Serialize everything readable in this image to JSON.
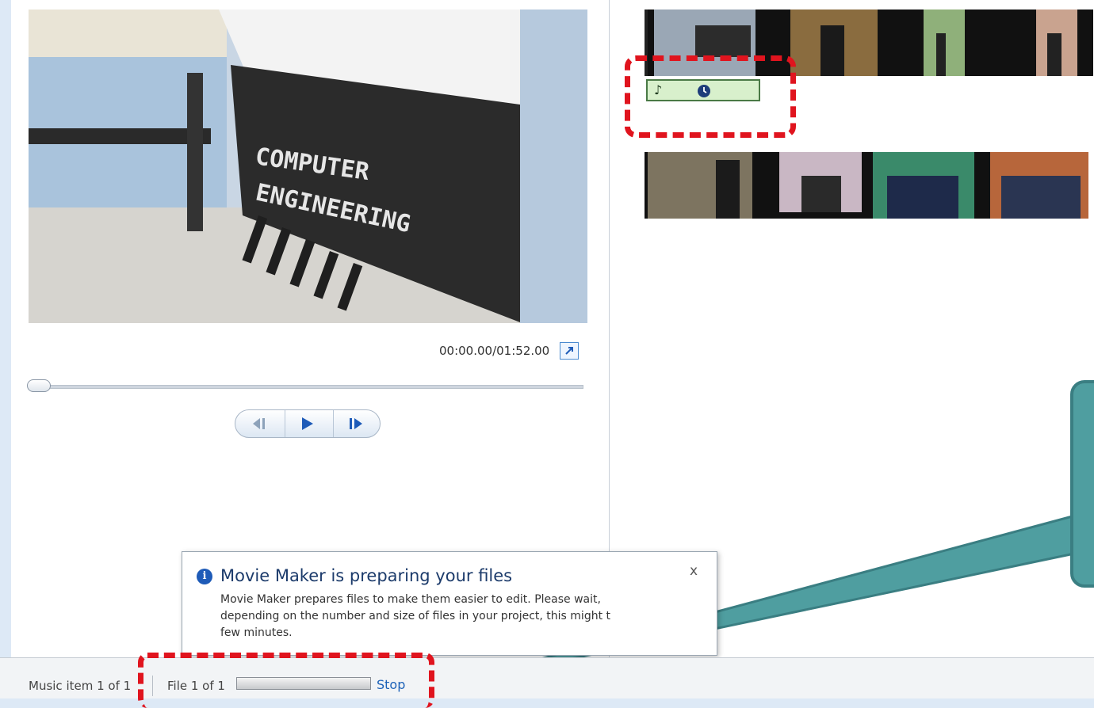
{
  "preview": {
    "timecode": "00:00.00/01:52.00",
    "fullscreen_icon": "expand-icon",
    "controls": [
      "previous-frame-icon",
      "play-icon",
      "next-frame-icon"
    ]
  },
  "storyboard": {
    "music_clip_icons": [
      "music-note-icon",
      "clock-icon"
    ]
  },
  "notification": {
    "title": "Movie Maker is preparing your files",
    "body": "Movie Maker prepares files to make them easier to edit. Please wait, depending on the number and size of files in your project, this might t",
    "body_line3": "few minutes.",
    "close_label": "x"
  },
  "status_bar": {
    "music_item": "Music item 1 of 1",
    "file_status": "File 1 of 1",
    "stop_label": "Stop"
  },
  "colors": {
    "annotation_red": "#e0141e",
    "callout_teal": "#4f9ea0",
    "music_clip_green": "#d8f0cc"
  }
}
